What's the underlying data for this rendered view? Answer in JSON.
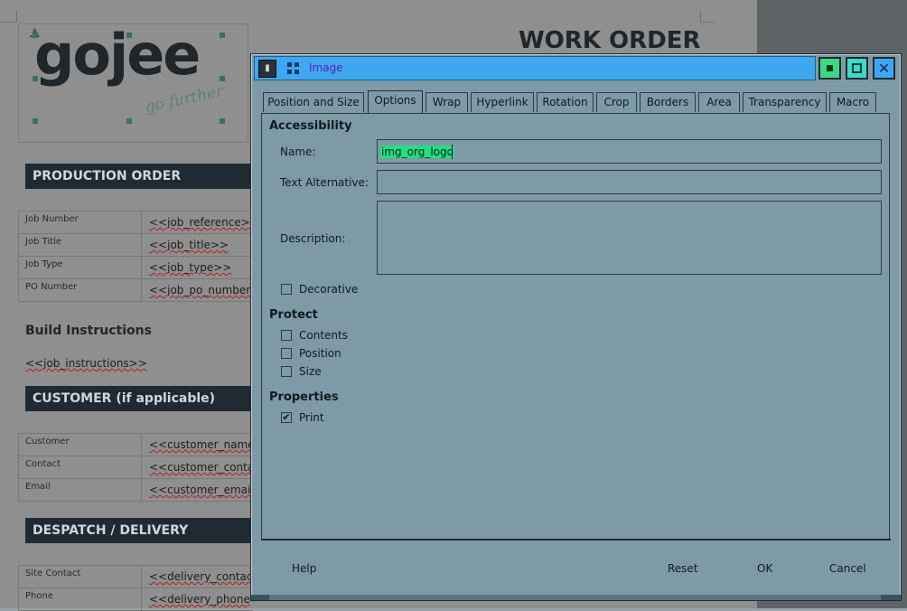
{
  "document": {
    "logo_text": "gojee",
    "logo_tagline": "go further",
    "title": "WORK ORDER",
    "sections": {
      "production": "PRODUCTION ORDER",
      "customer": "CUSTOMER (if applicable)",
      "despatch": "DESPATCH / DELIVERY"
    },
    "production_rows": [
      {
        "label": "Job Number",
        "value": "<<job_reference>>"
      },
      {
        "label": "Job Title",
        "value": "<<job_title>>"
      },
      {
        "label": "Job Type",
        "value": "<<job_type>>"
      },
      {
        "label": "PO Number",
        "value": "<<job_po_number"
      }
    ],
    "build_heading": "Build Instructions",
    "build_text": "<<job_instructions>>",
    "customer_rows": [
      {
        "label": "Customer",
        "value": "<<customer_name"
      },
      {
        "label": "Contact",
        "value": "<<customer_conta"
      },
      {
        "label": "Email",
        "value": "<<customer_email"
      }
    ],
    "despatch_rows": [
      {
        "label": "Site Contact",
        "value": "<<delivery_contac"
      },
      {
        "label": "Phone",
        "value": "<<delivery_phone"
      }
    ]
  },
  "dialog": {
    "title": "Image",
    "tabs": [
      {
        "label": "Position and Size",
        "active": false
      },
      {
        "label": "Options",
        "active": true
      },
      {
        "label": "Wrap",
        "active": false
      },
      {
        "label": "Hyperlink",
        "active": false
      },
      {
        "label": "Rotation",
        "active": false
      },
      {
        "label": "Crop",
        "active": false
      },
      {
        "label": "Borders",
        "active": false
      },
      {
        "label": "Area",
        "active": false
      },
      {
        "label": "Transparency",
        "active": false
      },
      {
        "label": "Macro",
        "active": false
      }
    ],
    "accessibility": {
      "heading": "Accessibility",
      "name_label": "Name:",
      "name_value": "img_org_logo",
      "alt_label": "Text Alternative:",
      "alt_value": "",
      "desc_label": "Description:",
      "desc_value": "",
      "decorative_label": "Decorative",
      "decorative_checked": false
    },
    "protect": {
      "heading": "Protect",
      "contents_label": "Contents",
      "position_label": "Position",
      "size_label": "Size"
    },
    "properties": {
      "heading": "Properties",
      "print_label": "Print",
      "print_checked": true,
      "print_mark": "✔"
    },
    "buttons": {
      "help": "Help",
      "reset": "Reset",
      "ok": "OK",
      "cancel": "Cancel"
    },
    "colors": {
      "titlebar": "#3fa7ef",
      "dialog_bg": "#7e9aa6",
      "selection": "#20e080"
    }
  }
}
